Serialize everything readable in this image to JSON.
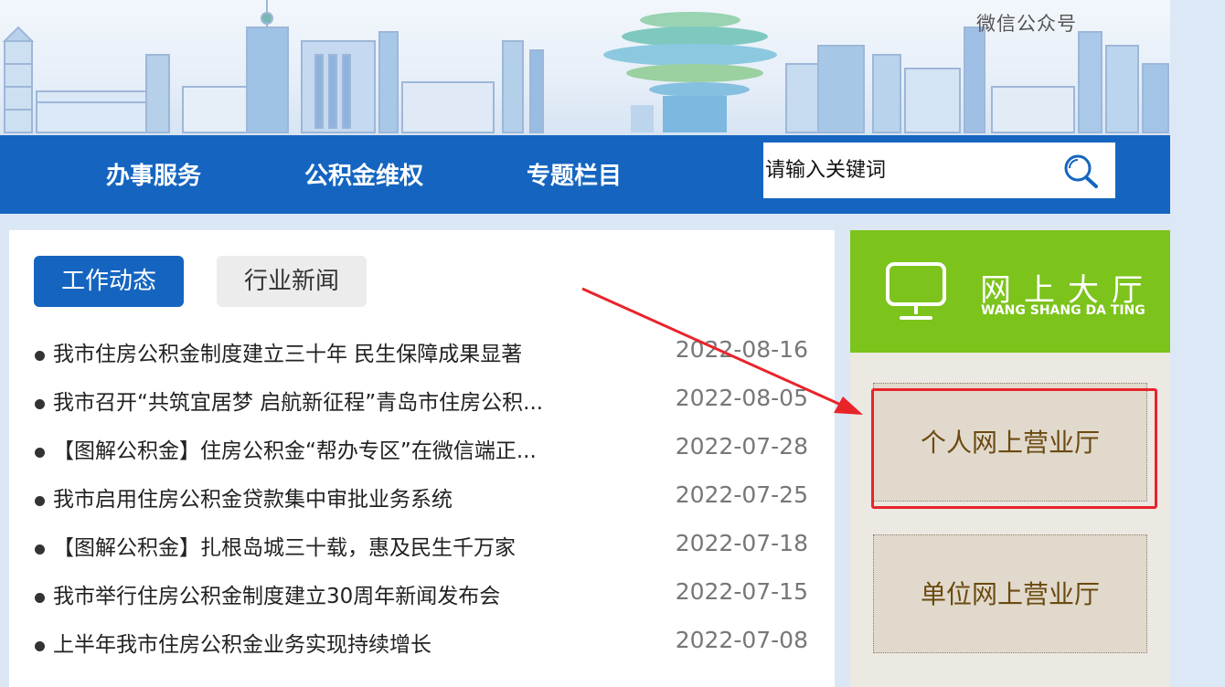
{
  "header": {
    "wechat_label": "微信公众号"
  },
  "nav": {
    "items": [
      "办事服务",
      "公积金维权",
      "专题栏目"
    ],
    "search_placeholder": "请输入关键词",
    "search_icon": "search-icon"
  },
  "news": {
    "tabs": [
      {
        "label": "工作动态",
        "active": true
      },
      {
        "label": "行业新闻",
        "active": false
      }
    ],
    "items": [
      {
        "title": "我市住房公积金制度建立三十年 民生保障成果显著",
        "date": "2022-08-16"
      },
      {
        "title": "我市召开“共筑宜居梦 启航新征程”青岛市住房公积...",
        "date": "2022-08-05"
      },
      {
        "title": "【图解公积金】住房公积金“帮办专区”在微信端正...",
        "date": "2022-07-28"
      },
      {
        "title": "我市启用住房公积金贷款集中审批业务系统",
        "date": "2022-07-25"
      },
      {
        "title": "【图解公积金】扎根岛城三十载，惠及民生千万家",
        "date": "2022-07-18"
      },
      {
        "title": "我市举行住房公积金制度建立30周年新闻发布会",
        "date": "2022-07-15"
      },
      {
        "title": "上半年我市住房公积金业务实现持续增长",
        "date": "2022-07-08"
      }
    ]
  },
  "side": {
    "hall_title": "网上大厅",
    "hall_subtitle": "WANG SHANG DA TING",
    "hall_icon": "monitor-icon",
    "personal_label": "个人网上营业厅",
    "company_label": "单位网上营业厅",
    "accent": "#7cc31c",
    "highlight_color": "#e8242b"
  },
  "colors": {
    "nav_blue": "#1565c0",
    "button_text": "#6b4a10"
  }
}
